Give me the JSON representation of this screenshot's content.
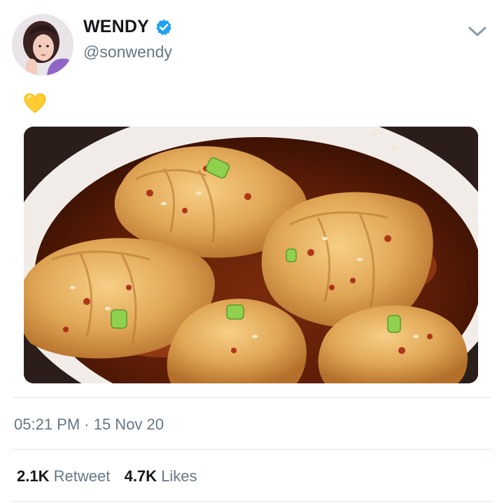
{
  "tweet": {
    "author": {
      "display_name": "WENDY",
      "handle": "@sonwendy",
      "verified": true
    },
    "text_emoji": "yellow-heart-icon",
    "media": {
      "subject": "dumplings in chili oil"
    },
    "timestamp": "05:21 PM · 15 Nov 20",
    "stats": {
      "retweets_count": "2.1K",
      "retweets_label": "Retweet",
      "likes_count": "4.7K",
      "likes_label": "Likes"
    }
  },
  "colors": {
    "verified_blue": "#1da1f2",
    "secondary_text": "#657786",
    "divider": "#e1e8ed",
    "heart_yellow": "#ffcc33"
  }
}
